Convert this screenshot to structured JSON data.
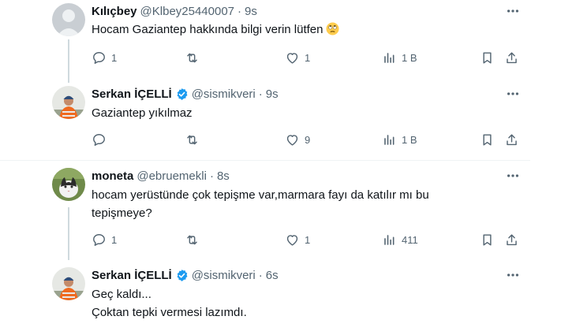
{
  "tweets": [
    {
      "name": "Kılıçbey",
      "handle": "@Klbey25440007",
      "dot": "·",
      "time": "9s",
      "verified": false,
      "lines": [
        "Hocam Gaziantep hakkında bilgi verin lütfen"
      ],
      "emoji": "face-with-rolling-eyes",
      "replies": "1",
      "retweets": "",
      "likes": "1",
      "views": "1 B"
    },
    {
      "name": "Serkan İÇELLİ",
      "handle": "@sismikveri",
      "dot": "·",
      "time": "9s",
      "verified": true,
      "lines": [
        "Gaziantep yıkılmaz"
      ],
      "replies": "",
      "retweets": "",
      "likes": "9",
      "views": "1 B"
    },
    {
      "name": "moneta",
      "handle": "@ebruemekli",
      "dot": "·",
      "time": "8s",
      "verified": false,
      "lines": [
        "hocam yerüstünde çok tepişme var,marmara fayı da katılır mı bu",
        "tepişmeye?"
      ],
      "replies": "1",
      "retweets": "",
      "likes": "1",
      "views": "411"
    },
    {
      "name": "Serkan İÇELLİ",
      "handle": "@sismikveri",
      "dot": "·",
      "time": "6s",
      "verified": true,
      "lines": [
        "Geç kaldı...",
        "Çoktan tepki vermesi lazımdı."
      ]
    }
  ],
  "colors": {
    "verified": "#1d9bf0",
    "muted": "#536471",
    "text": "#0f1419",
    "divider": "#eff3f4",
    "thread": "#cfd9de"
  }
}
